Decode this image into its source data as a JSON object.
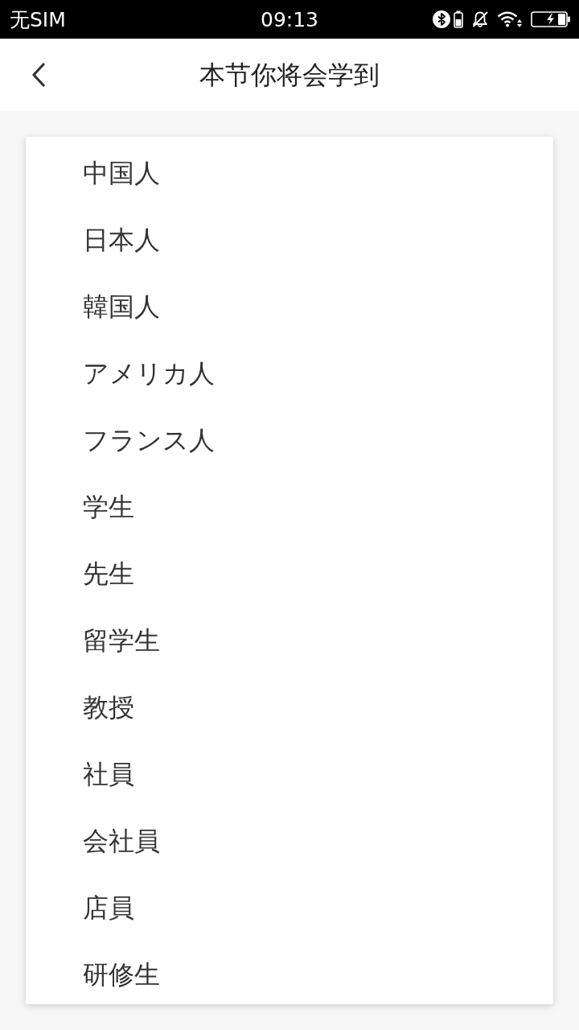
{
  "status_bar": {
    "carrier": "无SIM",
    "time": "09:13"
  },
  "header": {
    "title": "本节你将会学到"
  },
  "items": [
    "中国人",
    "日本人",
    "韓国人",
    "アメリカ人",
    "フランス人",
    "学生",
    "先生",
    "留学生",
    "教授",
    "社員",
    "会社員",
    "店員",
    "研修生"
  ]
}
